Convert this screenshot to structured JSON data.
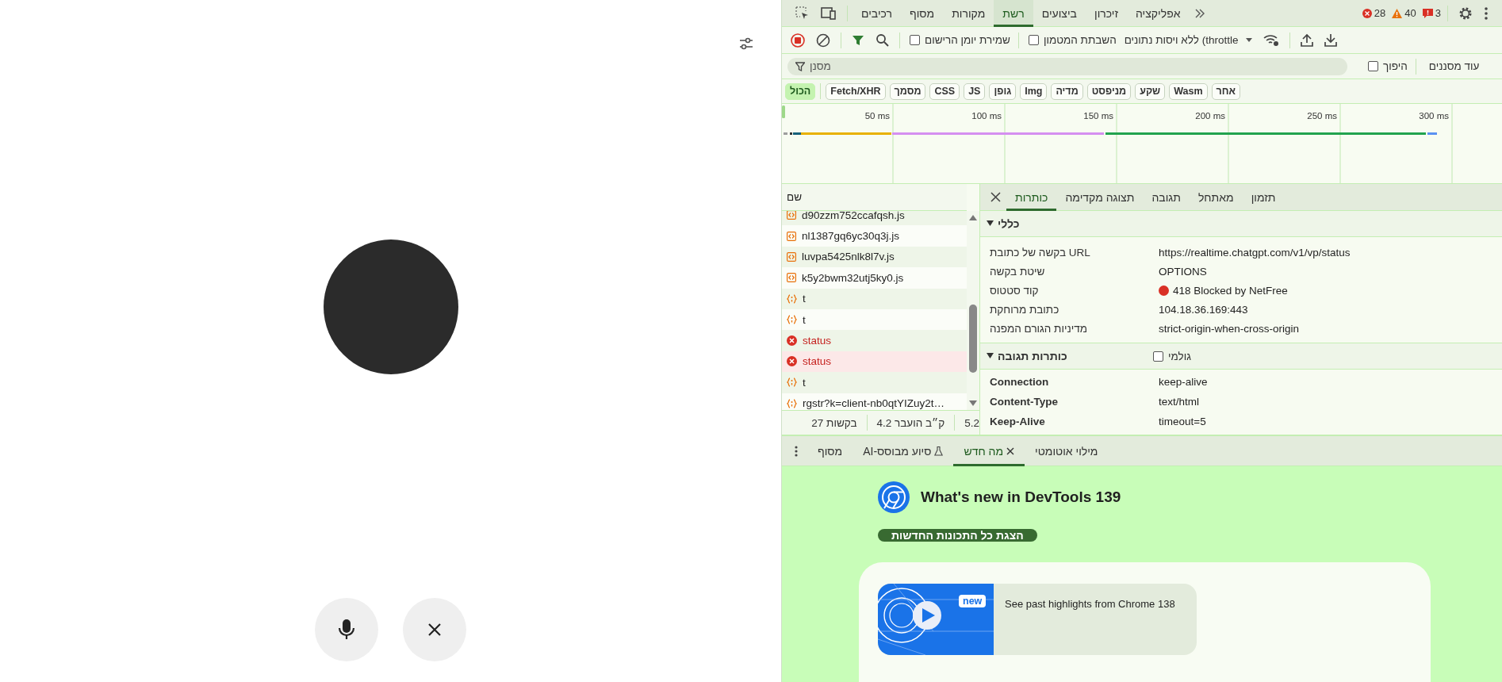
{
  "devtools": {
    "main_tabs": [
      {
        "label": "אפליקציה",
        "selected": false
      },
      {
        "label": "זיכרון",
        "selected": false
      },
      {
        "label": "ביצועים",
        "selected": false
      },
      {
        "label": "רשת",
        "selected": true
      },
      {
        "label": "מקורות",
        "selected": false
      },
      {
        "label": "מסוף",
        "selected": false
      },
      {
        "label": "רכיבים",
        "selected": false
      }
    ],
    "issue_counts": {
      "errors": "28",
      "warnings": "40",
      "issues": "3"
    },
    "toolbar": {
      "preserve_log": {
        "label": "שמירת יומן הרישום",
        "checked": false
      },
      "disable_cache": {
        "label": "השבתת המטמון",
        "checked": false
      },
      "throttling": "ללא ויסות נתונים (throttle"
    },
    "filter": {
      "placeholder": "מסנן",
      "invert": {
        "label": "היפוך",
        "checked": false
      },
      "more_filters": "עוד מסננים"
    },
    "type_chips": [
      {
        "label": "אחר",
        "selected": false
      },
      {
        "label": "Wasm",
        "selected": false
      },
      {
        "label": "שקע",
        "selected": false
      },
      {
        "label": "מניפסט",
        "selected": false
      },
      {
        "label": "מדיה",
        "selected": false
      },
      {
        "label": "Img",
        "selected": false
      },
      {
        "label": "גופן",
        "selected": false
      },
      {
        "label": "JS",
        "selected": false
      },
      {
        "label": "CSS",
        "selected": false
      },
      {
        "label": "מסמך",
        "selected": false
      },
      {
        "label": "Fetch/XHR",
        "selected": false
      },
      {
        "label": "הכול",
        "selected": true
      }
    ],
    "timeline": {
      "ticks": [
        "300 ms",
        "250 ms",
        "200 ms",
        "150 ms",
        "100 ms",
        "50 ms"
      ]
    },
    "requests": {
      "column": "שם",
      "rows": [
        {
          "name": "d90zzm752ccafqsh.js",
          "kind": "script",
          "selected": false
        },
        {
          "name": "nl1387gq6yc30q3j.js",
          "kind": "script",
          "selected": false
        },
        {
          "name": "luvpa5425nlk8l7v.js",
          "kind": "script",
          "selected": false
        },
        {
          "name": "k5y2bwm32utj5ky0.js",
          "kind": "script",
          "selected": false
        },
        {
          "name": "t",
          "kind": "fetch",
          "selected": false
        },
        {
          "name": "t",
          "kind": "fetch",
          "selected": false
        },
        {
          "name": "status",
          "kind": "error",
          "selected": false
        },
        {
          "name": "status",
          "kind": "error",
          "selected": true
        },
        {
          "name": "t",
          "kind": "fetch",
          "selected": false
        },
        {
          "name": "rgstr?k=client-nb0qtYIZuy2t…",
          "kind": "fetch",
          "selected": false
        }
      ]
    },
    "summary": [
      "5.2",
      "4.2 ק״ב הועבר",
      "27 בקשות"
    ],
    "details": {
      "tabs": [
        {
          "label": "תזמון",
          "selected": false
        },
        {
          "label": "מאתחל",
          "selected": false
        },
        {
          "label": "תגובה",
          "selected": false
        },
        {
          "label": "תצוגה מקדימה",
          "selected": false
        },
        {
          "label": "כותרות",
          "selected": true
        }
      ],
      "sections": [
        {
          "title": "כללי",
          "expanded": true,
          "rows": [
            {
              "name": "בקשה של כתובת URL",
              "value": "https://realtime.chatgpt.com/v1/vp/status",
              "kind": "text"
            },
            {
              "name": "שיטת בקשה",
              "value": "OPTIONS",
              "kind": "text"
            },
            {
              "name": "קוד סטטוס",
              "value": "418 Blocked by NetFree",
              "kind": "status"
            },
            {
              "name": "כתובת מרוחקת",
              "value": "104.18.36.169:443",
              "kind": "text"
            },
            {
              "name": "מדיניות הגורם המפנה",
              "value": "strict-origin-when-cross-origin",
              "kind": "text"
            }
          ]
        },
        {
          "title": "כותרות תגובה",
          "expanded": true,
          "raw": {
            "label": "גולמי",
            "checked": false
          },
          "rows": [
            {
              "name": "Connection",
              "value": "keep-alive",
              "kind": "header"
            },
            {
              "name": "Content-Type",
              "value": "text/html",
              "kind": "header"
            },
            {
              "name": "Keep-Alive",
              "value": "timeout=5",
              "kind": "header"
            }
          ]
        }
      ]
    },
    "drawer": {
      "tabs": [
        {
          "label": "מילוי אוטומטי",
          "kind": "plain",
          "selected": false,
          "closable": false
        },
        {
          "label": "מה חדש",
          "kind": "plain",
          "selected": true,
          "closable": true
        },
        {
          "label": "AI-סיוע מבוסס",
          "kind": "ai",
          "selected": false,
          "closable": false
        },
        {
          "label": "מסוף",
          "kind": "plain",
          "selected": false,
          "closable": false
        }
      ],
      "title": "What's new in DevTools 139",
      "button": "הצגת כל התכונות החדשות",
      "highlight": {
        "badge": "new",
        "text": "See past highlights from Chrome 138"
      }
    }
  }
}
